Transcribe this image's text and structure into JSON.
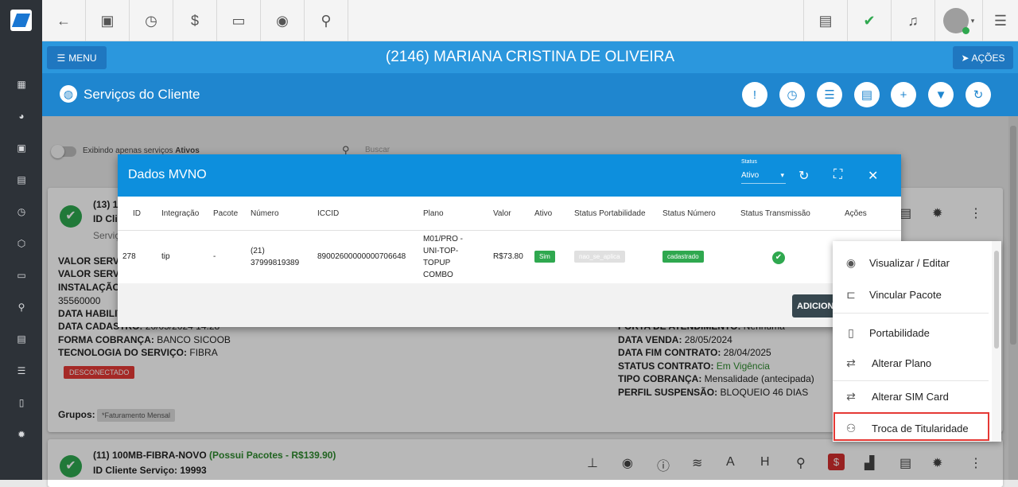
{
  "header": {
    "client_title": "(2146) MARIANA CRISTINA DE OLIVEIRA",
    "menu_label": "MENU",
    "acoes_label": "AÇÕES",
    "section_title": "Serviços do Cliente"
  },
  "filters": {
    "toggle_label_prefix": "Exibindo apenas serviços ",
    "toggle_label_bold": "Ativos",
    "search_placeholder": "Buscar"
  },
  "card1": {
    "title": "(13) 1",
    "id_label": "ID Cli",
    "servico_label": "Serviç",
    "lines_left": [
      {
        "label": "VALOR SERVIC",
        "value": ""
      },
      {
        "label": "VALOR SERVIC",
        "value": ""
      },
      {
        "label": "INSTALAÇÃO:",
        "value": ""
      },
      {
        "label": "",
        "value": "35560000"
      },
      {
        "label": "DATA HABILIT",
        "value": ""
      },
      {
        "label": "DATA CADASTRO:",
        "value": "20/05/2024 14:28"
      },
      {
        "label": "FORMA COBRANÇA:",
        "value": "BANCO SICOOB"
      },
      {
        "label": "TECNOLOGIA DO SERVIÇO:",
        "value": "FIBRA"
      }
    ],
    "lines_right": [
      {
        "label": "PORTA DE ATENDIMENTO:",
        "value": "Nenhuma"
      },
      {
        "label": "DATA VENDA:",
        "value": "28/05/2024"
      },
      {
        "label": "DATA FIM CONTRATO:",
        "value": "28/04/2025"
      },
      {
        "label": "STATUS CONTRATO:",
        "value": "Em Vigência"
      },
      {
        "label": "TIPO COBRANÇA:",
        "value": "Mensalidade (antecipada)"
      },
      {
        "label": "PERFIL SUSPENSÃO:",
        "value": "BLOQUEIO 46 DIAS"
      }
    ],
    "status_badge": "DESCONECTADO",
    "grupos_label": "Grupos:",
    "grupo_chip": "*Faturamento Mensal"
  },
  "card2": {
    "title_prefix": "(11) 100MB-FIBRA-NOVO",
    "title_suffix": " (Possui Pacotes - R$139.90)",
    "id_line": "ID Cliente Serviço: 19993"
  },
  "modal": {
    "title": "Dados MVNO",
    "status_label": "Status",
    "status_value": "Ativo",
    "columns": [
      "ID",
      "Integração",
      "Pacote",
      "Número",
      "ICCID",
      "Plano",
      "Valor",
      "Ativo",
      "Status Portabilidade",
      "Status Número",
      "Status Transmissão",
      "Ações"
    ],
    "row": {
      "id": "278",
      "integracao": "tip",
      "pacote": "-",
      "numero_1": "(21)",
      "numero_2": "37999819389",
      "iccid": "89002600000000706648",
      "plano_1": "M01/PRO -",
      "plano_2": "UNI-TOP-",
      "plano_3": "TOPUP",
      "plano_4": "COMBO",
      "valor": "R$73.80",
      "ativo": "Sim",
      "status_portabilidade": "nao_se_aplica",
      "status_numero": "cadastrado"
    },
    "add_button": "ADICION"
  },
  "dropdown": {
    "items": [
      {
        "label": "Visualizar / Editar",
        "icon": "eye-icon"
      },
      {
        "label": "Vincular Pacote",
        "icon": "link-nodes-icon"
      },
      {
        "label": "Portabilidade",
        "icon": "phone-icon"
      },
      {
        "label": "Alterar Plano",
        "icon": "swap-icon"
      },
      {
        "label": "Alterar SIM Card",
        "icon": "swap-icon"
      },
      {
        "label": "Troca de Titularidade",
        "icon": "people-icon"
      }
    ]
  },
  "colors": {
    "primary": "#2b97dd",
    "section": "#1f86cf",
    "modal_header": "#0d8fdd",
    "success": "#2fa84f",
    "danger": "#e53935"
  }
}
